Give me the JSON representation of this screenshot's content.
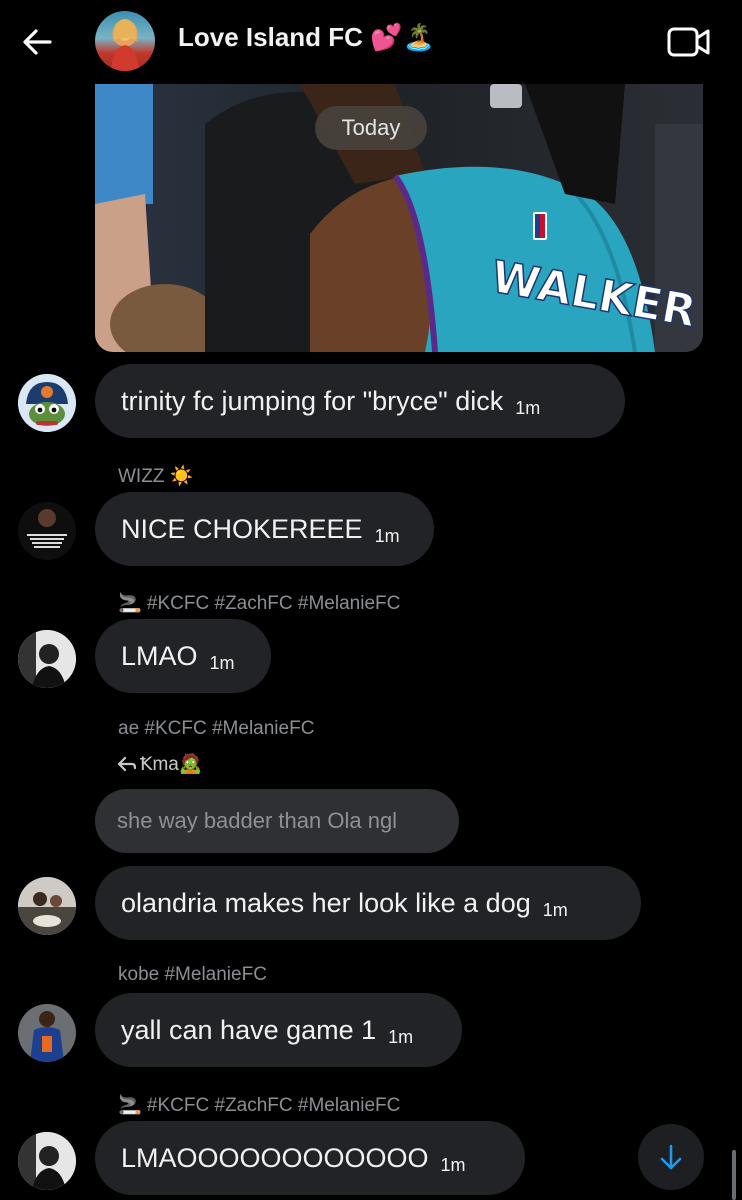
{
  "header": {
    "title": "Love Island FC 💕🏝️",
    "back_icon": "back-arrow-icon",
    "video_icon": "video-camera-icon"
  },
  "media": {
    "jersey_text": "WALKER"
  },
  "date_separator": "Today",
  "messages": [
    {
      "sender": "",
      "text": "trinity fc jumping for \"bryce\" dick",
      "time": "1m"
    },
    {
      "sender": "WIZZ ☀️",
      "text": "NICE CHOKEREEE",
      "time": "1m"
    },
    {
      "sender": "🚬 #KCFC #ZachFC #MelanieFC",
      "text": "LMAO",
      "time": "1m"
    },
    {
      "sender": "ae #KCFC #MelanieFC",
      "reply_to": "Ꝁma🧟",
      "quoted": "she way badder than Ola ngl"
    },
    {
      "sender": "",
      "text": "olandria makes her look like a dog",
      "time": "1m"
    },
    {
      "sender": "kobe #MelanieFC",
      "text": "yall can have game 1",
      "time": "1m"
    },
    {
      "sender": "🚬 #KCFC #ZachFC #MelanieFC",
      "text": "LMAOOOOOOOOOOOO",
      "time": "1m"
    }
  ],
  "colors": {
    "background": "#000000",
    "bubble": "#212327",
    "quoted_bubble": "#2f3033",
    "accent": "#1d9bf0"
  }
}
